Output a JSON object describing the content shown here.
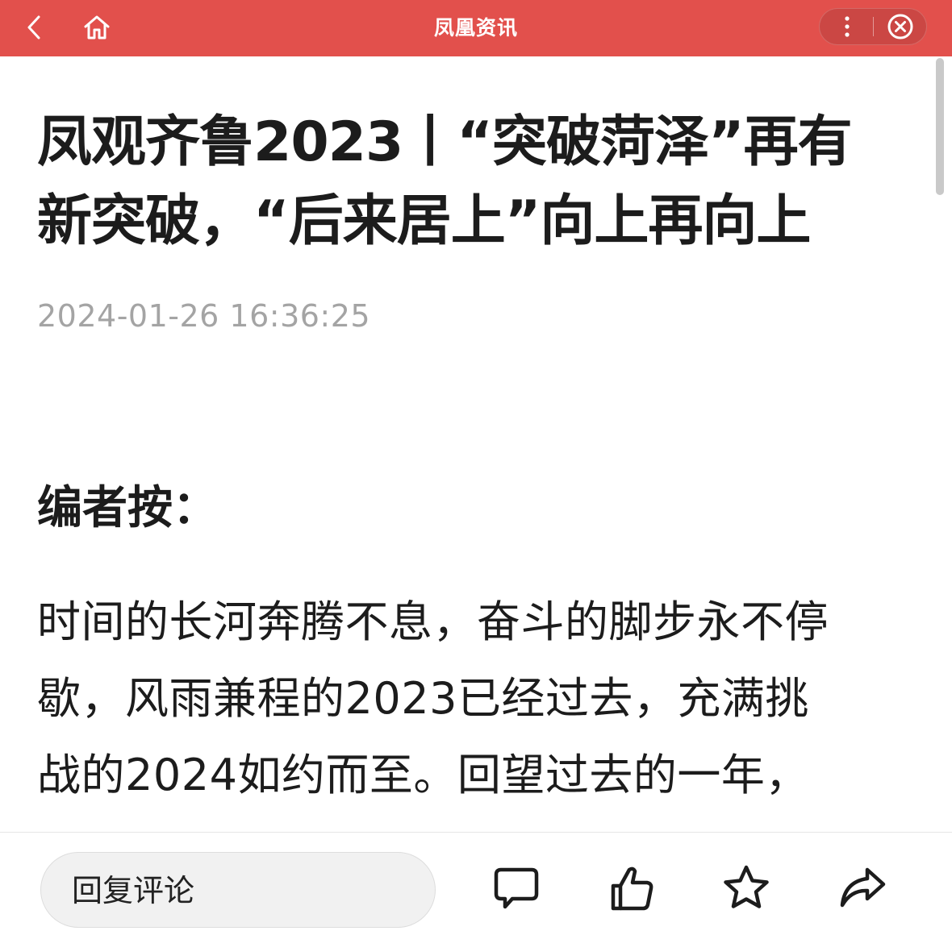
{
  "topbar": {
    "title": "凤凰资讯",
    "background": "#e2504c",
    "icons": [
      "back-icon",
      "home-icon",
      "more-icon",
      "close-icon"
    ]
  },
  "article": {
    "title": "凤观齐鲁2023丨“突破菏泽”再有\n新突破，“后来居上”向上再向上",
    "publish_time": "2024-01-26 16:36:25",
    "section_heading": "编者按：",
    "paragraph": "时间的长河奔腾不息，奋斗的脚步永不停\n歇，风雨兼程的2023已经过去，充满挑\n战的2024如约而至。回望过去的一年，"
  },
  "bottombar": {
    "reply_placeholder": "回复评论",
    "icons": [
      "comment-icon",
      "like-icon",
      "star-icon",
      "share-icon"
    ]
  }
}
